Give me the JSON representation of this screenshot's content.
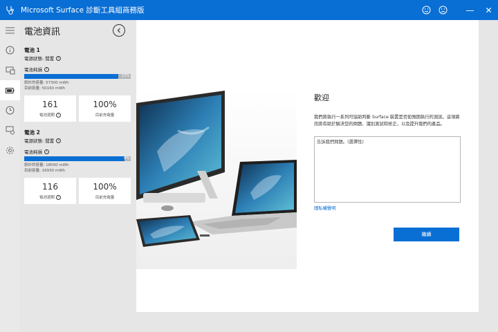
{
  "app": {
    "title": "Microsoft Surface 診斷工具組商務版",
    "accent": "#0a6fd4",
    "window_controls": {
      "minimize": "—",
      "close": "✕"
    }
  },
  "rail": {
    "items": [
      {
        "icon": "hamburger-menu-icon"
      },
      {
        "icon": "info-icon"
      },
      {
        "icon": "display-icon"
      },
      {
        "icon": "battery-icon",
        "active": true
      },
      {
        "icon": "clock-icon"
      },
      {
        "icon": "device-settings-icon"
      },
      {
        "icon": "gear-icon"
      }
    ]
  },
  "panel": {
    "title": "電池資訊",
    "batteries": [
      {
        "name": "電池 1",
        "state": "電源狀態: 閒置",
        "wear_label": "電池耗損",
        "wear_pct": 0.88,
        "wear_text": "12%",
        "design_capacity": "設計的容量: 57300 mWh",
        "current_capacity": "目前容量: 50160 mWh",
        "cycle_count": "161",
        "cycle_label": "電池週期",
        "charge_pct": "100%",
        "charge_label": "目前充電量"
      },
      {
        "name": "電池 2",
        "state": "電源狀態: 閒置",
        "wear_label": "電池耗損",
        "wear_pct": 0.94,
        "wear_text": "6%",
        "design_capacity": "設計的容量: 18000 mWh",
        "current_capacity": "目前容量: 16930 mWh",
        "cycle_count": "116",
        "cycle_label": "電池週期",
        "charge_pct": "100%",
        "charge_label": "目前充電量"
      }
    ]
  },
  "welcome": {
    "title": "歡迎",
    "description": "我們將執行一系列可協助判斷 Surface 裝置是否如預期執行的測試。這項資訊將有助於解決您的問題、識別測試和修正，以及提升我們的產品。",
    "feedback_placeholder": "告訴我們問題。(選擇性)",
    "privacy_link": "隱私權聲明",
    "continue_button": "繼續"
  }
}
